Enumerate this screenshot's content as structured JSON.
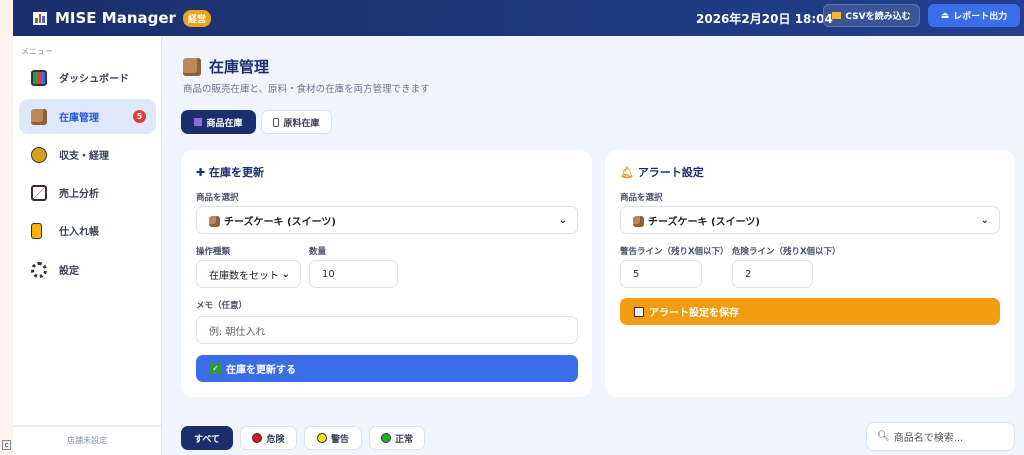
{
  "header": {
    "app_name": "MISE Manager",
    "badge": "経営",
    "datetime": "2026年2月20日 18:04",
    "csv_button": "CSVを読み込む",
    "report_button": "レポート出力"
  },
  "sidebar": {
    "menu_label": "メニュー",
    "items": [
      {
        "label": "ダッシュボード",
        "icon": "chart-icon"
      },
      {
        "label": "在庫管理",
        "icon": "box-icon",
        "badge": "5",
        "active": true
      },
      {
        "label": "収支・経理",
        "icon": "money-bag-icon"
      },
      {
        "label": "売上分析",
        "icon": "line-chart-icon"
      },
      {
        "label": "仕入れ帳",
        "icon": "ledger-icon"
      },
      {
        "label": "設定",
        "icon": "gear-icon"
      }
    ],
    "store": "店舗未設定"
  },
  "page": {
    "title": "在庫管理",
    "subtitle": "商品の販売在庫と、原料・食材の在庫を両方管理できます",
    "tabs": [
      "商品在庫",
      "原料在庫"
    ]
  },
  "update_card": {
    "title": "在庫を更新",
    "product_label": "商品を選択",
    "product_value": "チーズケーキ (スイーツ)",
    "op_label": "操作種類",
    "op_value": "在庫数をセット",
    "qty_label": "数量",
    "qty_value": "10",
    "memo_label": "メモ（任意）",
    "memo_placeholder": "例: 朝仕入れ",
    "submit": "在庫を更新する"
  },
  "alert_card": {
    "title": "アラート設定",
    "product_label": "商品を選択",
    "product_value": "チーズケーキ (スイーツ)",
    "warn_label": "警告ライン（残りX個以下）",
    "warn_value": "5",
    "danger_label": "危険ライン（残りX個以下）",
    "danger_value": "2",
    "save": "アラート設定を保存"
  },
  "filters": {
    "all": "すべて",
    "danger": "危険",
    "warning": "警告",
    "normal": "正常",
    "search_placeholder": "商品名で検索..."
  },
  "colors": {
    "navy": "#1b2f6b",
    "blue": "#3b6de8",
    "orange": "#f39c12"
  }
}
